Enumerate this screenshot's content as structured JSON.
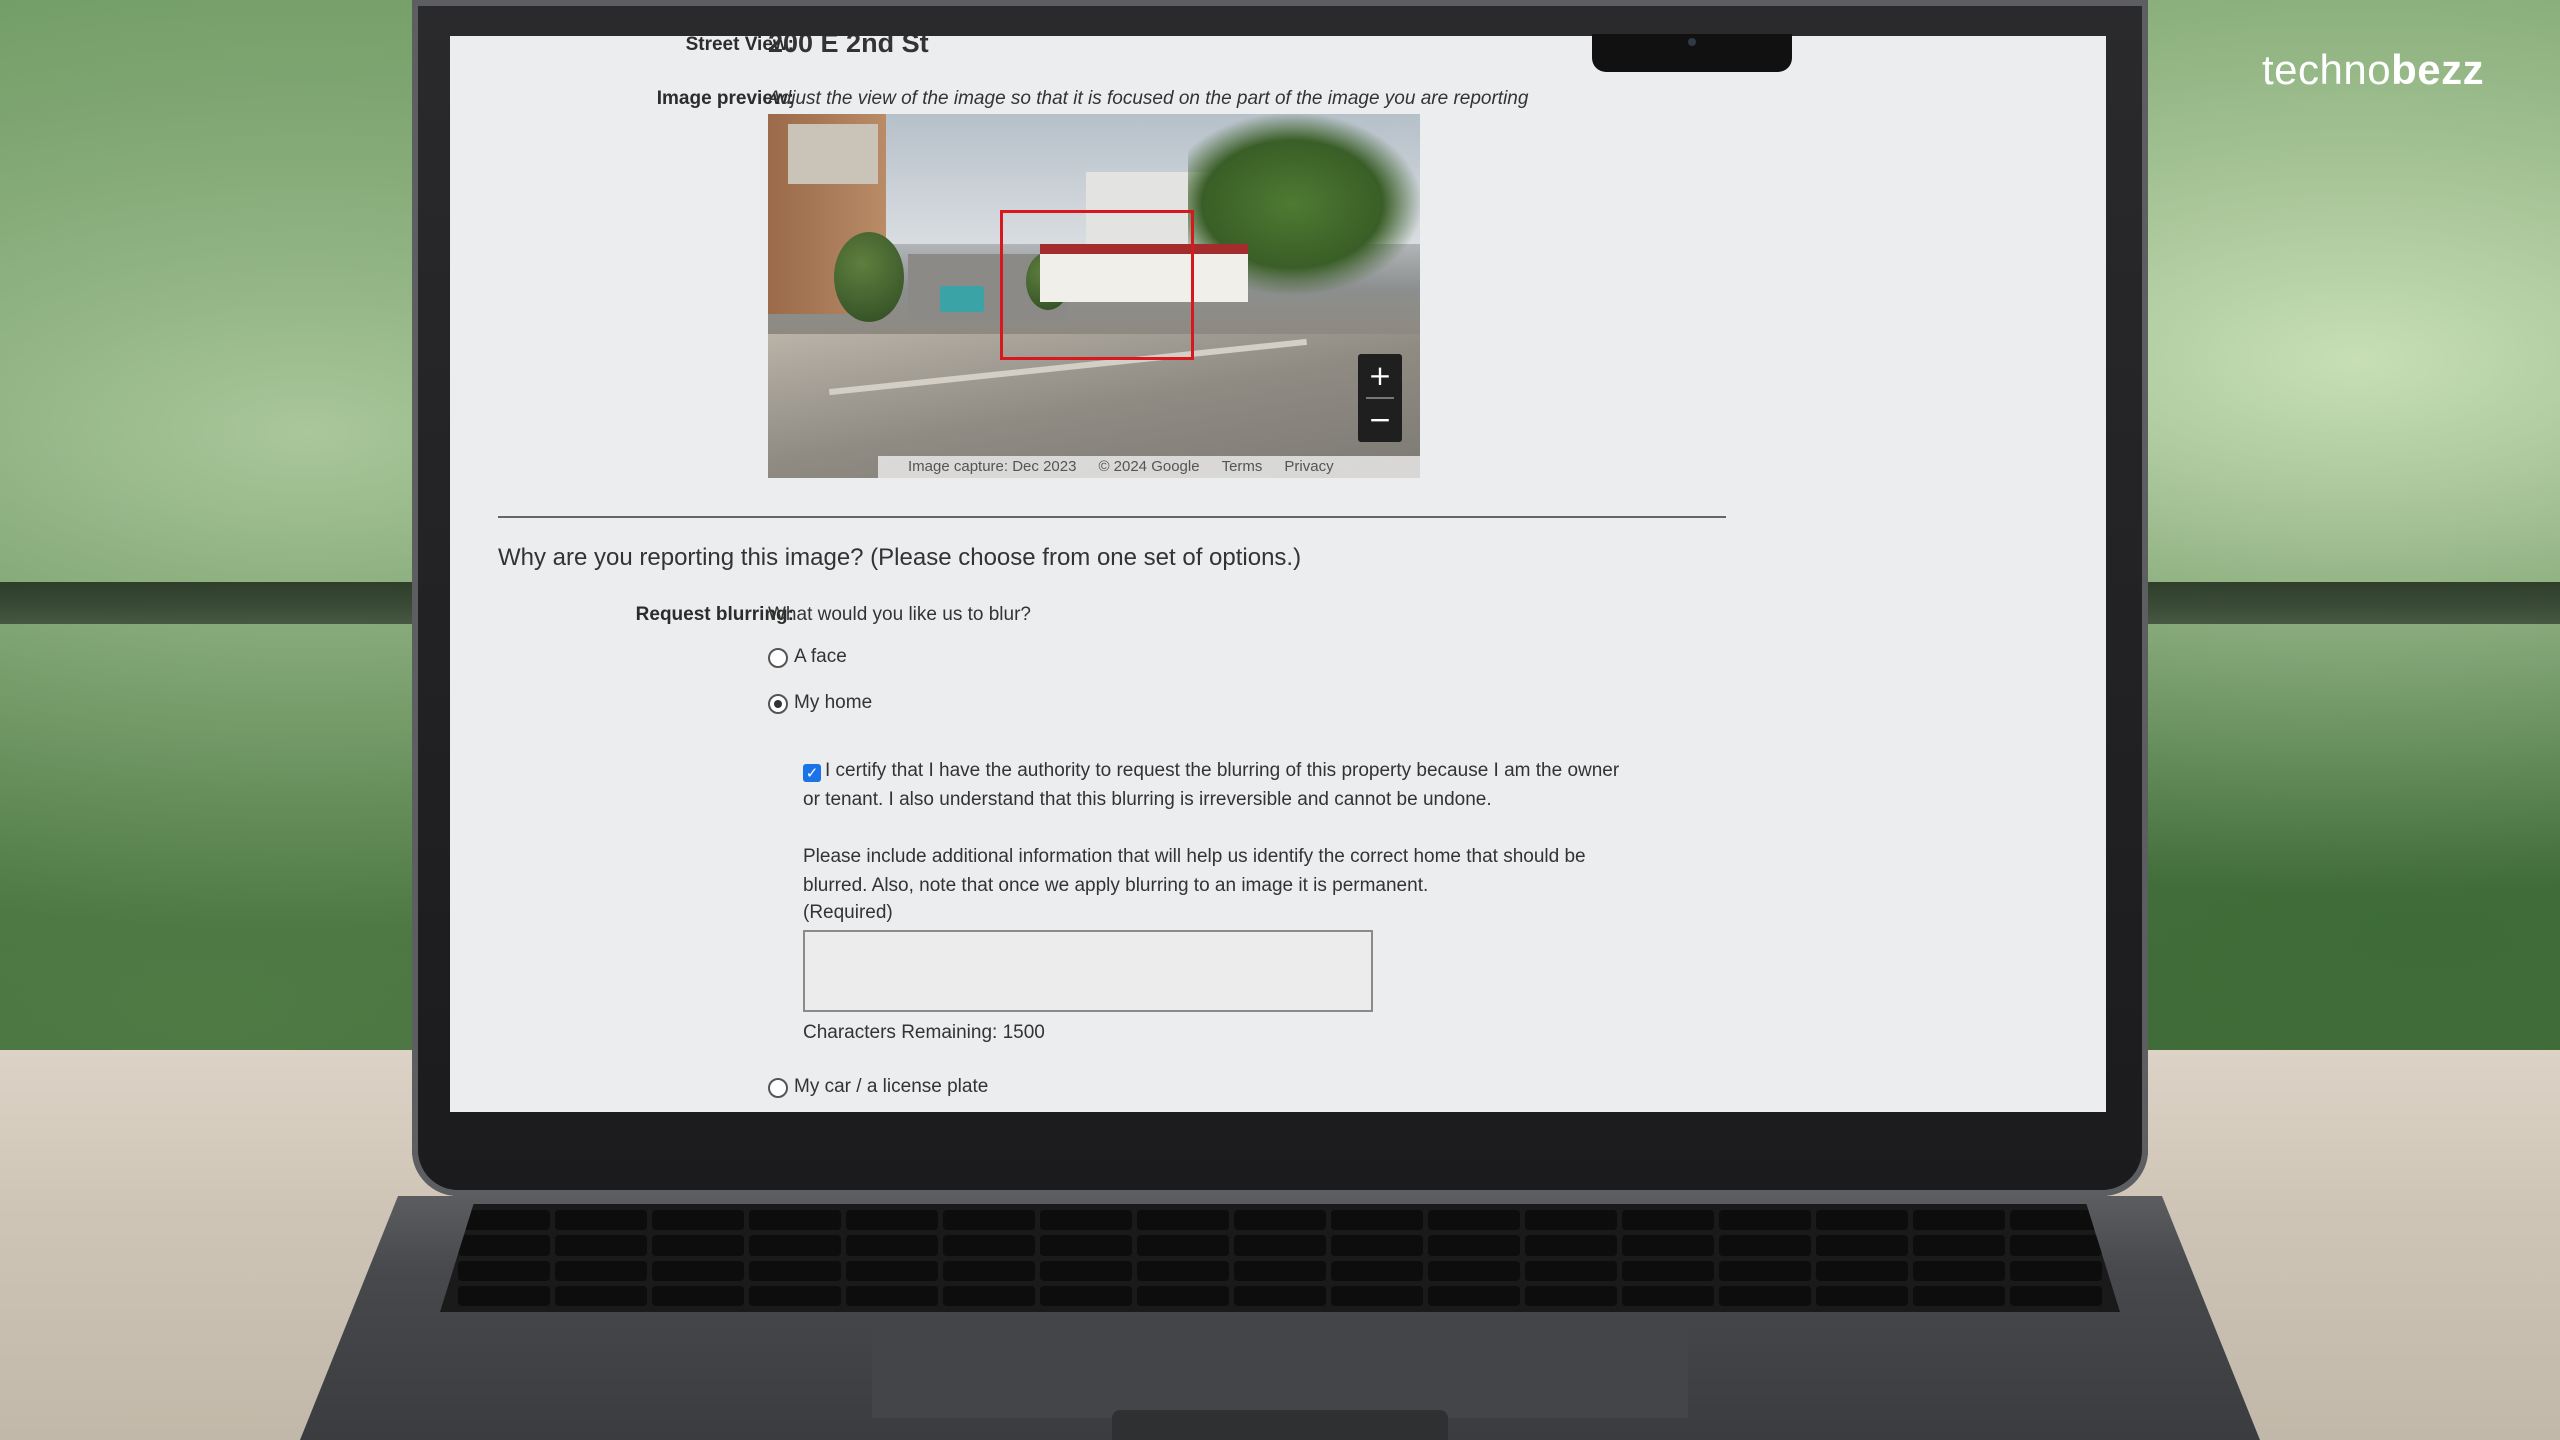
{
  "brand": {
    "prefix": "techno",
    "suffix": "bezz"
  },
  "form": {
    "street_view_label": "Street View:",
    "street_view_value": "200 E 2nd St",
    "image_preview_label": "Image preview:",
    "image_preview_instruction": "Adjust the view of the image so that it is focused on the part of the image you are reporting",
    "map_attribution": {
      "capture": "Image capture: Dec 2023",
      "copyright": "© 2024 Google",
      "terms": "Terms",
      "privacy": "Privacy"
    },
    "zoom_in": "+",
    "zoom_out": "−",
    "question": "Why are you reporting this image?  (Please choose from one set of options.)",
    "request_blurring_label": "Request blurring:",
    "request_blurring_prompt": "What would you like us to blur?",
    "options": [
      {
        "label": "A face",
        "selected": false
      },
      {
        "label": "My home",
        "selected": true
      },
      {
        "label": "My car / a license plate",
        "selected": false
      }
    ],
    "certify_checked": true,
    "certify_text": "I certify that I have the authority to request the blurring of this property because I am the owner or tenant. I also understand that this blurring is irreversible and cannot be undone.",
    "info_text": "Please include additional information that will help us identify the correct home that should be blurred. Also, note that once we apply blurring to an image it is permanent.",
    "required_text": "(Required)",
    "textarea_value": "",
    "characters_remaining_label": "Characters Remaining:",
    "characters_remaining_value": "1500"
  }
}
